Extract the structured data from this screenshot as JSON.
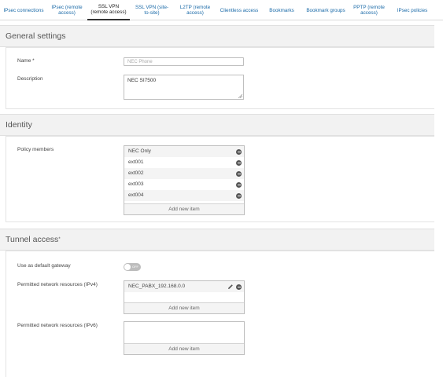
{
  "tabs": [
    {
      "label": "IPsec connections"
    },
    {
      "label": "IPsec (remote access)"
    },
    {
      "label": "SSL VPN (remote access)"
    },
    {
      "label": "SSL VPN (site-to-site)"
    },
    {
      "label": "L2TP (remote access)"
    },
    {
      "label": "Clientless access"
    },
    {
      "label": "Bookmarks"
    },
    {
      "label": "Bookmark groups"
    },
    {
      "label": "PPTP (remote access)"
    },
    {
      "label": "IPsec policies"
    }
  ],
  "general": {
    "title": "General settings",
    "name_label": "Name *",
    "name_value": "NEC Phone",
    "description_label": "Description",
    "description_value": "NEC SI7500"
  },
  "identity": {
    "title": "Identity",
    "policy_members_label": "Policy members",
    "members": [
      "NEC Only",
      "ext001",
      "ext002",
      "ext003",
      "ext004"
    ],
    "add_new_item": "Add new item"
  },
  "tunnel": {
    "title": "Tunnel access",
    "title_marker": "*",
    "default_gateway_label": "Use as default gateway",
    "default_gateway_state": "OFF",
    "ipv4_label": "Permitted network resources (IPv4)",
    "ipv4_items": [
      "NEC_PABX_192.168.0.0"
    ],
    "ipv4_add": "Add new item",
    "ipv6_label": "Permitted network resources (IPv6)",
    "ipv6_add": "Add new item"
  }
}
